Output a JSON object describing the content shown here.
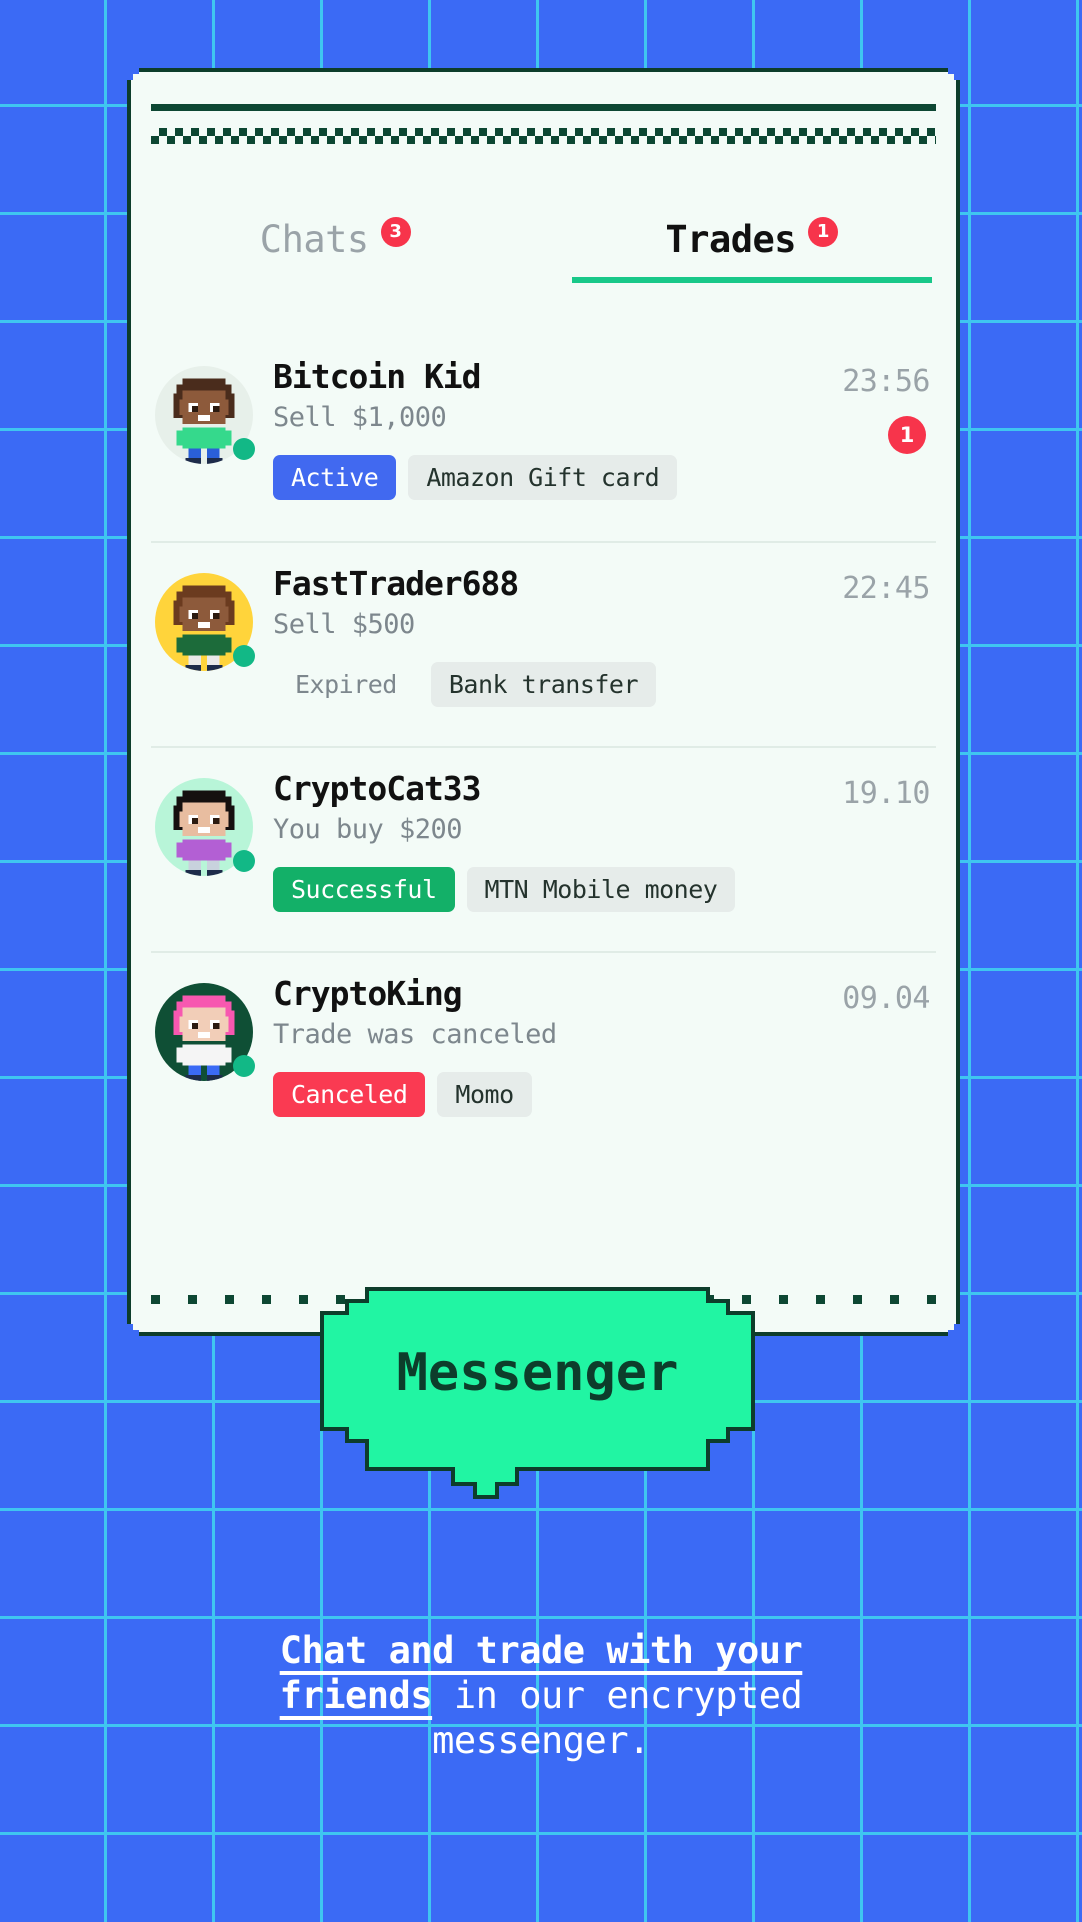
{
  "colors": {
    "background": "#3b6af5",
    "grid_line": "#3fc6f0",
    "card_bg": "#f3fbf7",
    "card_border": "#0d3d2b",
    "accent_green": "#18c889",
    "bubble_green": "#21f5a3",
    "badge_red": "#f7344b",
    "chip_active_blue": "#4169f0",
    "chip_success_green": "#13b068",
    "chip_canceled_red": "#fa3a52",
    "chip_method_grey": "#e6ecea",
    "muted_text": "#7d878d"
  },
  "tabs": [
    {
      "id": "chats",
      "label": "Chats",
      "badge": "3",
      "active": false
    },
    {
      "id": "trades",
      "label": "Trades",
      "badge": "1",
      "active": true
    }
  ],
  "trades": [
    {
      "username": "Bitcoin Kid",
      "subtitle": "Sell $1,000",
      "time": "23:56",
      "unread": "1",
      "status": {
        "label": "Active",
        "kind": "active"
      },
      "method": "Amazon Gift card",
      "online": true,
      "avatar": "avatar-bitcoin-kid"
    },
    {
      "username": "FastTrader688",
      "subtitle": "Sell $500",
      "time": "22:45",
      "unread": "",
      "status": {
        "label": "Expired",
        "kind": "plain"
      },
      "method": "Bank transfer",
      "online": true,
      "avatar": "avatar-fasttrader688"
    },
    {
      "username": "CryptoCat33",
      "subtitle": "You buy $200",
      "time": "19.10",
      "unread": "",
      "status": {
        "label": "Successful",
        "kind": "successful"
      },
      "method": "MTN Mobile money",
      "online": true,
      "avatar": "avatar-cryptocat33"
    },
    {
      "username": "CryptoKing",
      "subtitle": "Trade was canceled",
      "time": "09.04",
      "unread": "",
      "status": {
        "label": "Canceled",
        "kind": "canceled"
      },
      "method": "Momo",
      "online": true,
      "avatar": "avatar-cryptoking"
    }
  ],
  "bubble": {
    "label": "Messenger"
  },
  "caption": {
    "highlight": "Chat and trade with your friends",
    "rest": " in our encrypted messenger."
  }
}
